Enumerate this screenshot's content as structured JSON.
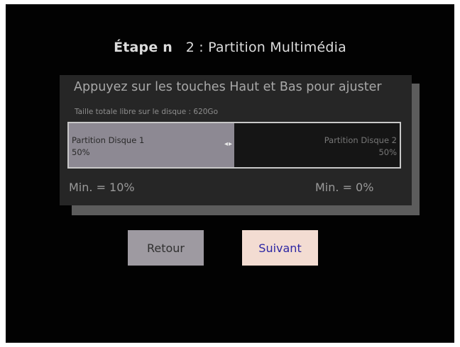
{
  "title": {
    "step": "Étape n",
    "rest": "2 : Partition Multimédia"
  },
  "panel": {
    "instruction": "Appuyez sur les touches Haut et Bas pour ajuster",
    "free_size": "Taille totale libre sur le disque :  620Go"
  },
  "partitions": [
    {
      "label": "Partition Disque 1",
      "percent": "50%",
      "fill_fraction": 0.5
    },
    {
      "label": "Partition Disque 2",
      "percent": "50%",
      "fill_fraction": 0.5
    }
  ],
  "adjust_arrows": "◂▸",
  "minimums": {
    "left": "Min. = 10%",
    "right": "Min. = 0%"
  },
  "buttons": {
    "back": "Retour",
    "next": "Suivant"
  },
  "colors": {
    "background": "#020202",
    "panel": "#262626",
    "disk1_fill": "#8d8993",
    "next_button": "#f3dcd2",
    "next_text": "#2c26a4",
    "back_button": "#9e9aa1"
  }
}
